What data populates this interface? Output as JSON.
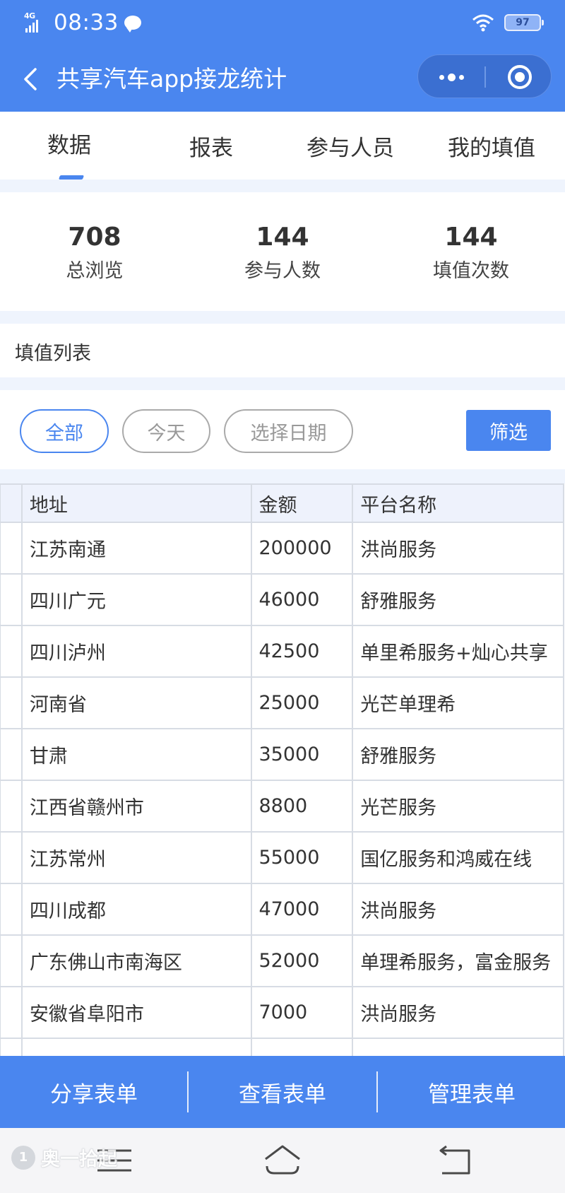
{
  "status_bar": {
    "network": "4G",
    "time": "08:33",
    "battery": "97",
    "icons": [
      "signal-icon",
      "message-icon",
      "wifi-icon",
      "battery-icon"
    ]
  },
  "titlebar": {
    "title": "共享汽车app接龙统计",
    "icons": [
      "back-icon",
      "more-icon",
      "close-icon"
    ]
  },
  "tabs": [
    {
      "label": "数据",
      "active": true
    },
    {
      "label": "报表",
      "active": false
    },
    {
      "label": "参与人员",
      "active": false
    },
    {
      "label": "我的填值",
      "active": false
    }
  ],
  "stats": [
    {
      "value": "708",
      "label": "总浏览"
    },
    {
      "value": "144",
      "label": "参与人数"
    },
    {
      "value": "144",
      "label": "填值次数"
    }
  ],
  "section_title": "填值列表",
  "filters": {
    "pills": [
      {
        "label": "全部",
        "active": true
      },
      {
        "label": "今天",
        "active": false
      },
      {
        "label": "选择日期",
        "active": false
      }
    ],
    "button": "筛选"
  },
  "table": {
    "headers": [
      "地址",
      "金额",
      "平台名称"
    ],
    "rows": [
      [
        "江苏南通",
        "200000",
        "洪尚服务"
      ],
      [
        "四川广元",
        "46000",
        "舒雅服务"
      ],
      [
        "四川泸州",
        "42500",
        "单里希服务+灿心共享"
      ],
      [
        "河南省",
        "25000",
        "光芒单理希"
      ],
      [
        "甘肃",
        "35000",
        "舒雅服务"
      ],
      [
        "江西省赣州市",
        "8800",
        "光芒服务"
      ],
      [
        "江苏常州",
        "55000",
        "国亿服务和鸿威在线"
      ],
      [
        "四川成都",
        "47000",
        "洪尚服务"
      ],
      [
        "广东佛山市南海区",
        "52000",
        "单理希服务，富金服务"
      ],
      [
        "安徽省阜阳市",
        "7000",
        "洪尚服务"
      ],
      [
        "",
        "",
        ""
      ]
    ]
  },
  "actions": [
    "分享表单",
    "查看表单",
    "管理表单"
  ],
  "navbar": {
    "icons": [
      "menu-icon",
      "home-icon",
      "back-nav-icon"
    ],
    "watermark": {
      "badge": "1",
      "text": "奥一拾起"
    }
  },
  "colors": {
    "primary": "#4a86ef",
    "band": "#eff4fd",
    "table_header": "#eef2fc",
    "border": "#d7dce4"
  }
}
